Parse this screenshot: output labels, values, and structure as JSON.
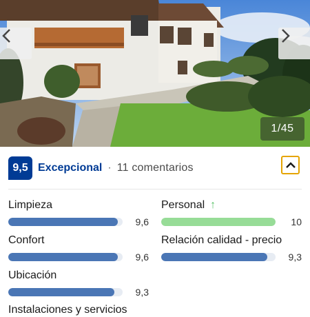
{
  "gallery": {
    "counter": "1/45",
    "prev_icon": "chevron-left-icon",
    "next_icon": "chevron-right-icon"
  },
  "summary": {
    "score": "9,5",
    "word": "Excepcional",
    "separator": "·",
    "reviews": "11 comentarios",
    "collapse_icon": "chevron-up-icon",
    "badge_color": "#003b95",
    "accent_color": "#e5a400"
  },
  "categories": [
    {
      "label": "Limpieza",
      "value": "9,6",
      "score": 9.6,
      "color": "#4a76b5"
    },
    {
      "label": "Personal",
      "value": "10",
      "score": 10,
      "color": "#97dc97",
      "trend_icon": "arrow-up-icon"
    },
    {
      "label": "Confort",
      "value": "9,6",
      "score": 9.6,
      "color": "#4a76b5"
    },
    {
      "label": "Relación calidad - precio",
      "value": "9,3",
      "score": 9.3,
      "color": "#4a76b5"
    },
    {
      "label": "Ubicación",
      "value": "9,3",
      "score": 9.3,
      "color": "#4a76b5"
    },
    {
      "label": "Instalaciones y servicios",
      "value": "",
      "color": "#4a76b5"
    }
  ],
  "trend_arrow": "↑"
}
